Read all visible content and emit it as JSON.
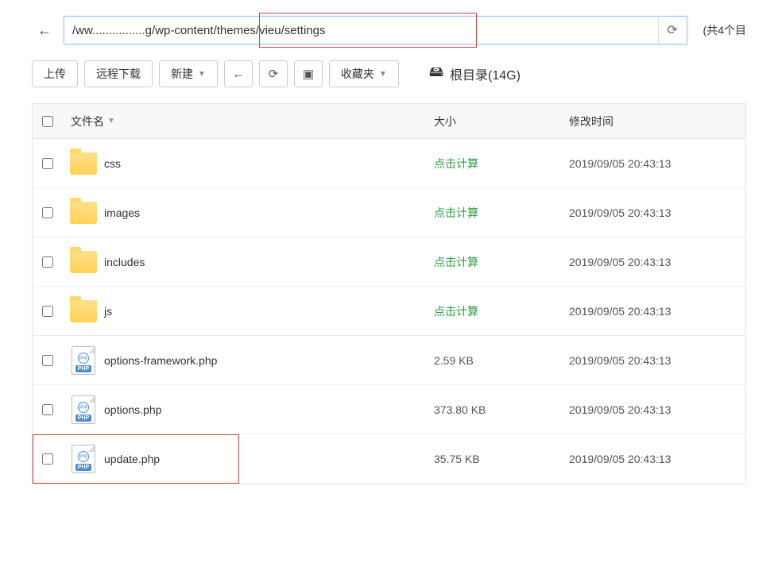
{
  "pathbar": {
    "path_prefix": "/ww",
    "path_suffix": "g/wp-content/themes/vieu/settings",
    "count_text": "(共4个目"
  },
  "toolbar": {
    "upload": "上传",
    "remote_download": "远程下载",
    "new": "新建",
    "favorites": "收藏夹"
  },
  "root": {
    "label": "根目录(14G)"
  },
  "columns": {
    "name": "文件名",
    "size": "大小",
    "modified": "修改时间"
  },
  "rows": [
    {
      "type": "folder",
      "name": "css",
      "size": "点击计算",
      "date": "2019/09/05 20:43:13"
    },
    {
      "type": "folder",
      "name": "images",
      "size": "点击计算",
      "date": "2019/09/05 20:43:13"
    },
    {
      "type": "folder",
      "name": "includes",
      "size": "点击计算",
      "date": "2019/09/05 20:43:13"
    },
    {
      "type": "folder",
      "name": "js",
      "size": "点击计算",
      "date": "2019/09/05 20:43:13"
    },
    {
      "type": "php",
      "name": "options-framework.php",
      "size": "2.59 KB",
      "date": "2019/09/05 20:43:13"
    },
    {
      "type": "php",
      "name": "options.php",
      "size": "373.80 KB",
      "date": "2019/09/05 20:43:13"
    },
    {
      "type": "php",
      "name": "update.php",
      "size": "35.75 KB",
      "date": "2019/09/05 20:43:13",
      "highlighted": true
    }
  ]
}
